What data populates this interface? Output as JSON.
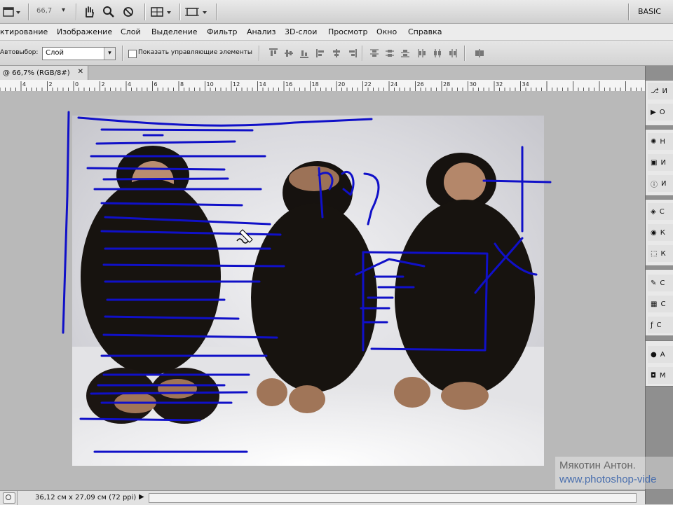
{
  "app": {
    "workspace_label": "BASIC",
    "zoom_value": "66,7"
  },
  "menu": [
    "ктирование",
    "Изображение",
    "Слой",
    "Выделение",
    "Фильтр",
    "Анализ",
    "3D-слои",
    "Просмотр",
    "Окно",
    "Справка"
  ],
  "options_bar": {
    "autoselect_label": "Автовыбор:",
    "autoselect_value": "Слой",
    "show_controls_label": "Показать управляющие элементы"
  },
  "document": {
    "tab_title": "@ 66,7% (RGB/8#)"
  },
  "ruler_labels": [
    "4",
    "2",
    "0",
    "2",
    "4",
    "6",
    "8",
    "10",
    "12",
    "14",
    "16",
    "18",
    "20",
    "22",
    "24",
    "26",
    "28",
    "30",
    "32",
    "34"
  ],
  "status": {
    "doc_size": "36,12 см x 27,09 см (72 ppi)"
  },
  "right_panel": {
    "items": [
      {
        "icon": "history-icon",
        "label": "И"
      },
      {
        "icon": "actions-icon",
        "label": "О"
      },
      {
        "icon": "adjustments-icon",
        "label": "Н"
      },
      {
        "icon": "image-icon",
        "label": "И"
      },
      {
        "icon": "info-icon",
        "label": "И"
      },
      {
        "icon": "layers-icon",
        "label": "С"
      },
      {
        "icon": "masks-icon",
        "label": "К"
      },
      {
        "icon": "transform-icon",
        "label": "К"
      },
      {
        "icon": "paths-icon",
        "label": "С"
      },
      {
        "icon": "channels-icon",
        "label": "С"
      },
      {
        "icon": "styles-icon",
        "label": "С"
      },
      {
        "icon": "brush-icon",
        "label": "А"
      },
      {
        "icon": "notes-icon",
        "label": "М"
      }
    ]
  },
  "watermark": {
    "author": "Мякотин Антон.",
    "site": "www.photoshop-vide"
  },
  "colors": {
    "drawing_stroke": "#1010c8",
    "workspace": "#b9b9b9"
  }
}
